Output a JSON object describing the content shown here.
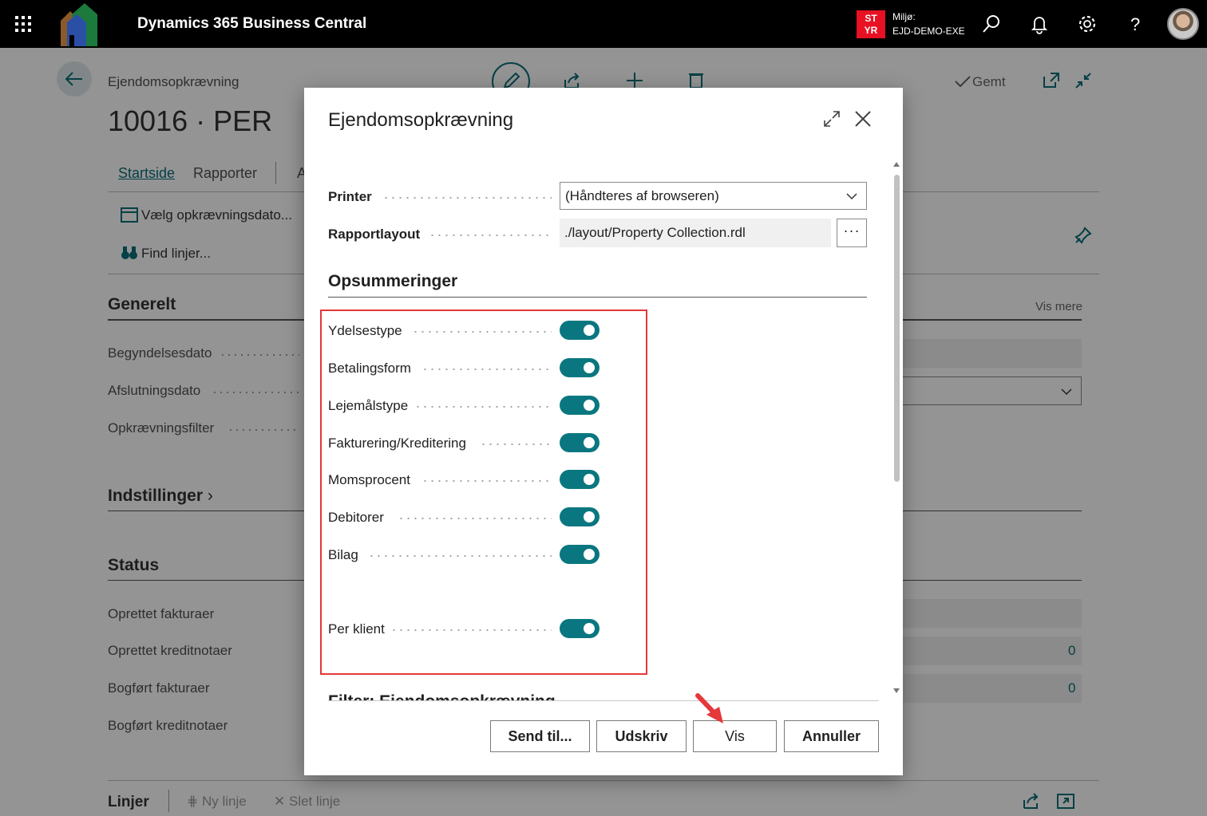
{
  "topbar": {
    "app_title": "Dynamics 365 Business Central",
    "env_badge_line1": "ST",
    "env_badge_line2": "YR",
    "env_label": "Miljø:",
    "env_name": "EJD-DEMO-EXE",
    "icons": [
      "app-launcher-icon",
      "search-icon",
      "bell-icon",
      "gear-icon",
      "help-icon"
    ]
  },
  "page": {
    "breadcrumb": "Ejendomsopkrævning",
    "title": "10016 · PER",
    "saved_status": "Gemt",
    "tabs": [
      "Startside",
      "Rapporter",
      "A"
    ],
    "actions": [
      "Vælg opkrævningsdato...",
      "Find linjer..."
    ],
    "sections": {
      "general": "Generelt",
      "general_fields": [
        "Begyndelsesdato",
        "Afslutningsdato",
        "Opkrævningsfilter"
      ],
      "show_more": "Vis mere",
      "settings": "Indstillinger",
      "status": "Status",
      "status_fields": [
        "Oprettet fakturaer",
        "Oprettet kreditnotaer",
        "Bogført fakturaer",
        "Bogført kreditnotaer"
      ],
      "status_values": [
        "0",
        "0"
      ]
    },
    "lines": {
      "title": "Linjer",
      "new_line": "Ny linje",
      "delete_line": "Slet linje"
    }
  },
  "dialog": {
    "title": "Ejendomsopkrævning",
    "printer_label": "Printer",
    "printer_value": "(Håndteres af browseren)",
    "layout_label": "Rapportlayout",
    "layout_value": "./layout/Property Collection.rdl",
    "ellipsis": "···",
    "summaries_title": "Opsummeringer",
    "toggles": [
      {
        "label": "Ydelsestype",
        "on": true
      },
      {
        "label": "Betalingsform",
        "on": true
      },
      {
        "label": "Lejemålstype",
        "on": true
      },
      {
        "label": "Fakturering/Kreditering",
        "on": true
      },
      {
        "label": "Momsprocent",
        "on": true
      },
      {
        "label": "Debitorer",
        "on": true
      },
      {
        "label": "Bilag",
        "on": true
      },
      {
        "label": "Per klient",
        "on": true
      }
    ],
    "next_section_partial": "Filter: Ejendomsopkrævning",
    "buttons": {
      "send": "Send til...",
      "print": "Udskriv",
      "view": "Vis",
      "cancel": "Annuller"
    },
    "highlight_color": "#e5383b",
    "accent_color": "#0a7780"
  }
}
